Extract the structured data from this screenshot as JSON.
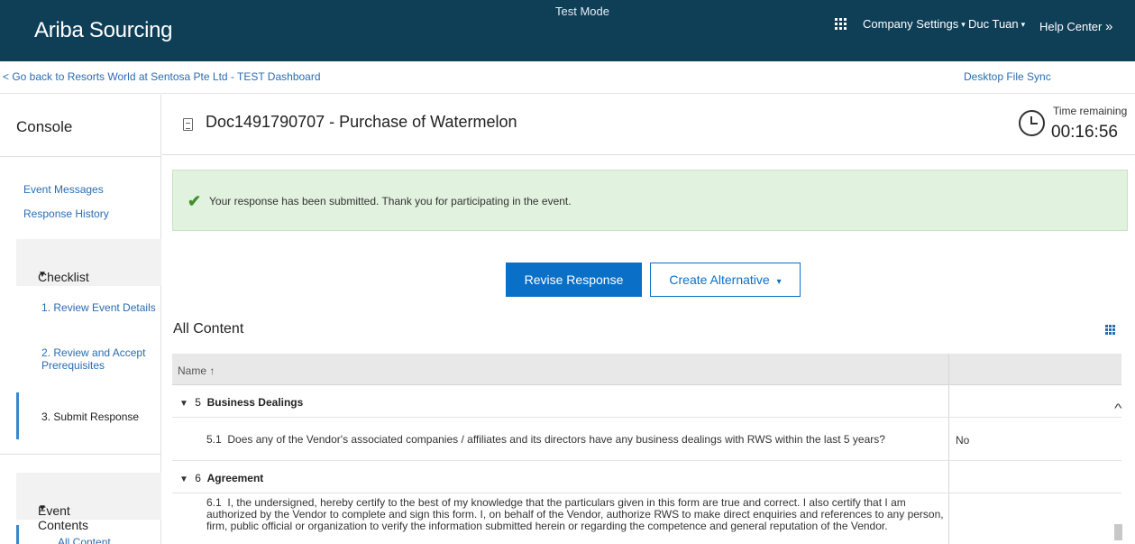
{
  "header": {
    "brand": "Ariba Sourcing",
    "mode": "Test Mode",
    "company_settings": "Company Settings",
    "user": "Duc Tuan",
    "help": "Help Center",
    "help_arrow": "»",
    "caret": "▾",
    "apps_icon": "grid-icon"
  },
  "subheader": {
    "back_link": "< Go back to Resorts World at Sentosa Pte Ltd - TEST Dashboard",
    "desktop_sync": "Desktop File Sync"
  },
  "sidebar": {
    "title": "Console",
    "links": [
      "Event Messages",
      "Response History"
    ],
    "checklist": {
      "label": "Checklist",
      "arrow": "▼",
      "steps": [
        {
          "num": "1.",
          "label": "Review Event Details"
        },
        {
          "num": "2.",
          "label": "Review and Accept Prerequisites"
        },
        {
          "num": "3.",
          "label": "Submit Response",
          "active": true
        }
      ]
    },
    "event_contents": {
      "label": "Event Contents",
      "arrow": "▼",
      "items": [
        "All Content"
      ]
    }
  },
  "document": {
    "title": "Doc1491790707 - Purchase of Watermelon",
    "time_label": "Time remaining",
    "time_value": "00:16:56"
  },
  "alert": {
    "icon": "✔",
    "message": "Your response has been submitted.  Thank you for participating in the event."
  },
  "actions": {
    "revise": "Revise Response",
    "alternative": "Create Alternative",
    "alternative_caret": "▾"
  },
  "content": {
    "title": "All Content",
    "table_header": "Name ↑",
    "groups": [
      {
        "arrow": "▼",
        "num": "5",
        "title": "Business Dealings",
        "questions": [
          {
            "num": "5.1",
            "text": "Does any of the Vendor's associated companies / affiliates and its directors have any business dealings with RWS within the last 5 years?",
            "answer": "No"
          }
        ]
      },
      {
        "arrow": "▼",
        "num": "6",
        "title": "Agreement",
        "questions": [
          {
            "num": "6.1",
            "text": "I, the undersigned, hereby certify to the best of my knowledge that the particulars given in this form are true and correct. I also certify that I am authorized by the Vendor to complete and sign this form. I, on behalf of the Vendor, authorize RWS to make direct enquiries and references to any person, firm, public official or organization to verify the information submitted herein or regarding the competence and general reputation of the Vendor.",
            "answer": ""
          }
        ]
      }
    ]
  },
  "scrollbar": {
    "up_arrow": "^"
  },
  "colors": {
    "topbar": "#0f3e57",
    "link": "#2a6db1",
    "primary": "#0a70c7",
    "alert_bg": "#e1f2de",
    "check": "#3f8f2e"
  }
}
